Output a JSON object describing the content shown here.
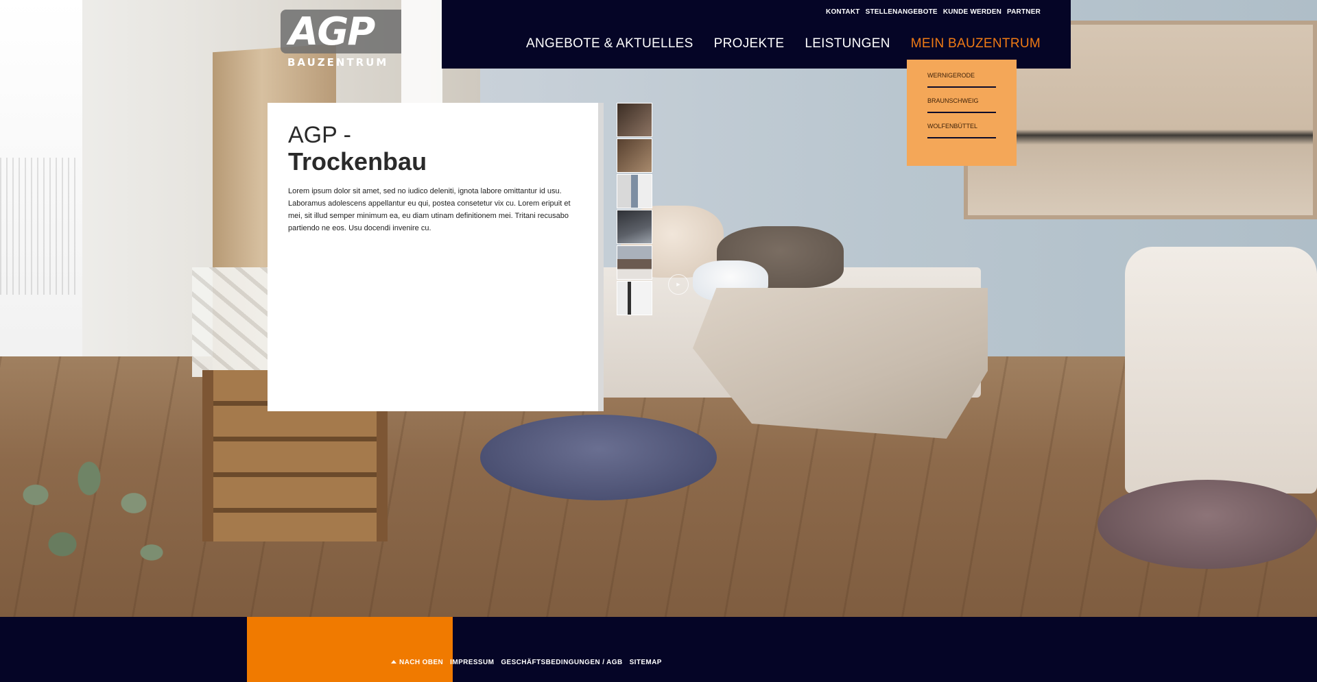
{
  "logo": {
    "letters": "AGP",
    "subtitle": "BAUZENTRUM"
  },
  "utility_nav": [
    "KONTAKT",
    "STELLENANGEBOTE",
    "KUNDE WERDEN",
    "PARTNER"
  ],
  "main_nav": [
    {
      "label": "ANGEBOTE & AKTUELLES",
      "active": false
    },
    {
      "label": "PROJEKTE",
      "active": false
    },
    {
      "label": "LEISTUNGEN",
      "active": false
    },
    {
      "label": "MEIN BAUZENTRUM",
      "active": true
    }
  ],
  "dropdown": [
    "WERNIGERODE",
    "BRAUNSCHWEIG",
    "WOLFENBÜTTEL"
  ],
  "card": {
    "title_line1": "AGP -",
    "title_line2": "Trockenbau",
    "body": "Lorem ipsum dolor sit amet, sed no iudico deleniti, ignota labore omittantur id usu. Laboramus adolescens appellantur eu qui, postea consetetur vix cu. Lorem eripuit et mei, sit illud semper minimum ea, eu diam utinam definitionem mei. Tritani recusabo partiendo ne eos. Usu docendi invenire cu."
  },
  "gallery": {
    "thumbnail_count": 6,
    "next_icon": "arrow-right-icon"
  },
  "footer": {
    "back_to_top": "NACH OBEN",
    "links": [
      "IMPRESSUM",
      "GESCHÄFTSBEDINGUNGEN / AGB",
      "SITEMAP"
    ]
  },
  "colors": {
    "navy": "#050526",
    "accent_orange": "#f07a00",
    "dropdown_orange": "#f4a758",
    "active_nav": "#f07a14"
  }
}
